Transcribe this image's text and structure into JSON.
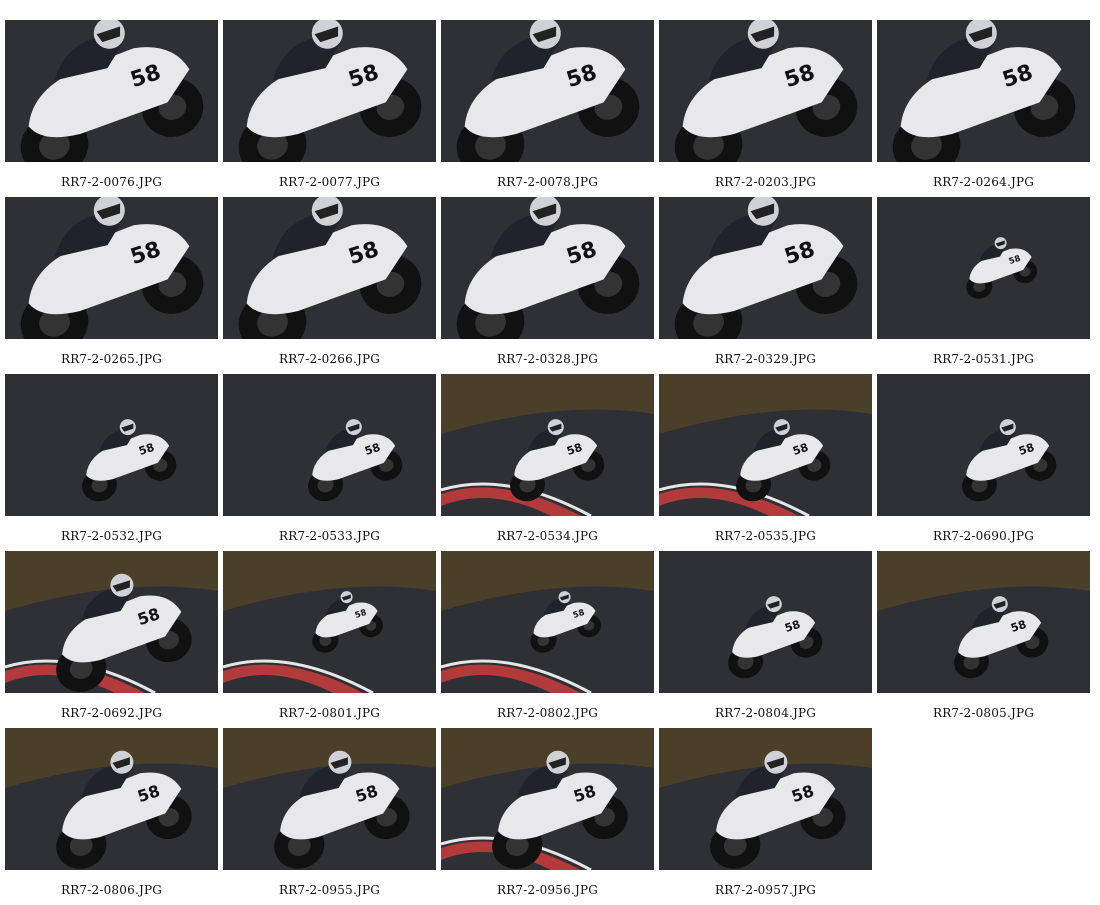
{
  "gallery": {
    "items": [
      {
        "filename": "RR7-2-0076.JPG",
        "shot": "close",
        "number": "58",
        "curb": false,
        "grass": false
      },
      {
        "filename": "RR7-2-0077.JPG",
        "shot": "close",
        "number": "58",
        "curb": false,
        "grass": false
      },
      {
        "filename": "RR7-2-0078.JPG",
        "shot": "close",
        "number": "58",
        "curb": false,
        "grass": false
      },
      {
        "filename": "RR7-2-0203.JPG",
        "shot": "close",
        "number": "58",
        "curb": false,
        "grass": false
      },
      {
        "filename": "RR7-2-0264.JPG",
        "shot": "close",
        "number": "58",
        "curb": false,
        "grass": false
      },
      {
        "filename": "RR7-2-0265.JPG",
        "shot": "close",
        "number": "58",
        "curb": false,
        "grass": false
      },
      {
        "filename": "RR7-2-0266.JPG",
        "shot": "close",
        "number": "58",
        "curb": false,
        "grass": false
      },
      {
        "filename": "RR7-2-0328.JPG",
        "shot": "close",
        "number": "58",
        "curb": false,
        "grass": false
      },
      {
        "filename": "RR7-2-0329.JPG",
        "shot": "close",
        "number": "58",
        "curb": false,
        "grass": false
      },
      {
        "filename": "RR7-2-0531.JPG",
        "shot": "far",
        "number": "58",
        "curb": false,
        "grass": false
      },
      {
        "filename": "RR7-2-0532.JPG",
        "shot": "mid",
        "number": "58",
        "curb": false,
        "grass": false
      },
      {
        "filename": "RR7-2-0533.JPG",
        "shot": "mid",
        "number": "58",
        "curb": false,
        "grass": false
      },
      {
        "filename": "RR7-2-0534.JPG",
        "shot": "mid",
        "number": "58",
        "curb": true,
        "grass": true
      },
      {
        "filename": "RR7-2-0535.JPG",
        "shot": "mid",
        "number": "58",
        "curb": true,
        "grass": true
      },
      {
        "filename": "RR7-2-0690.JPG",
        "shot": "mid",
        "number": "58",
        "curb": false,
        "grass": false
      },
      {
        "filename": "RR7-2-0692.JPG",
        "shot": "side",
        "number": "58",
        "curb": true,
        "grass": true
      },
      {
        "filename": "RR7-2-0801.JPG",
        "shot": "far",
        "number": "58",
        "curb": true,
        "grass": true
      },
      {
        "filename": "RR7-2-0802.JPG",
        "shot": "far",
        "number": "58",
        "curb": true,
        "grass": true
      },
      {
        "filename": "RR7-2-0804.JPG",
        "shot": "mid",
        "number": "58",
        "curb": false,
        "grass": false
      },
      {
        "filename": "RR7-2-0805.JPG",
        "shot": "mid",
        "number": "58",
        "curb": false,
        "grass": true
      },
      {
        "filename": "RR7-2-0806.JPG",
        "shot": "side",
        "number": "58",
        "curb": false,
        "grass": true
      },
      {
        "filename": "RR7-2-0955.JPG",
        "shot": "side",
        "number": "58",
        "curb": false,
        "grass": true
      },
      {
        "filename": "RR7-2-0956.JPG",
        "shot": "side",
        "number": "58",
        "curb": true,
        "grass": true
      },
      {
        "filename": "RR7-2-0957.JPG",
        "shot": "side",
        "number": "58",
        "curb": false,
        "grass": true
      }
    ]
  },
  "colors": {
    "asphalt": "#2e3036",
    "grass": "#4a3f28",
    "fairing": "#e8e8ea",
    "rider": "#20232a",
    "curb_red": "#b23a3a",
    "curb_white": "#e6e6e6",
    "caption": "#111111"
  }
}
